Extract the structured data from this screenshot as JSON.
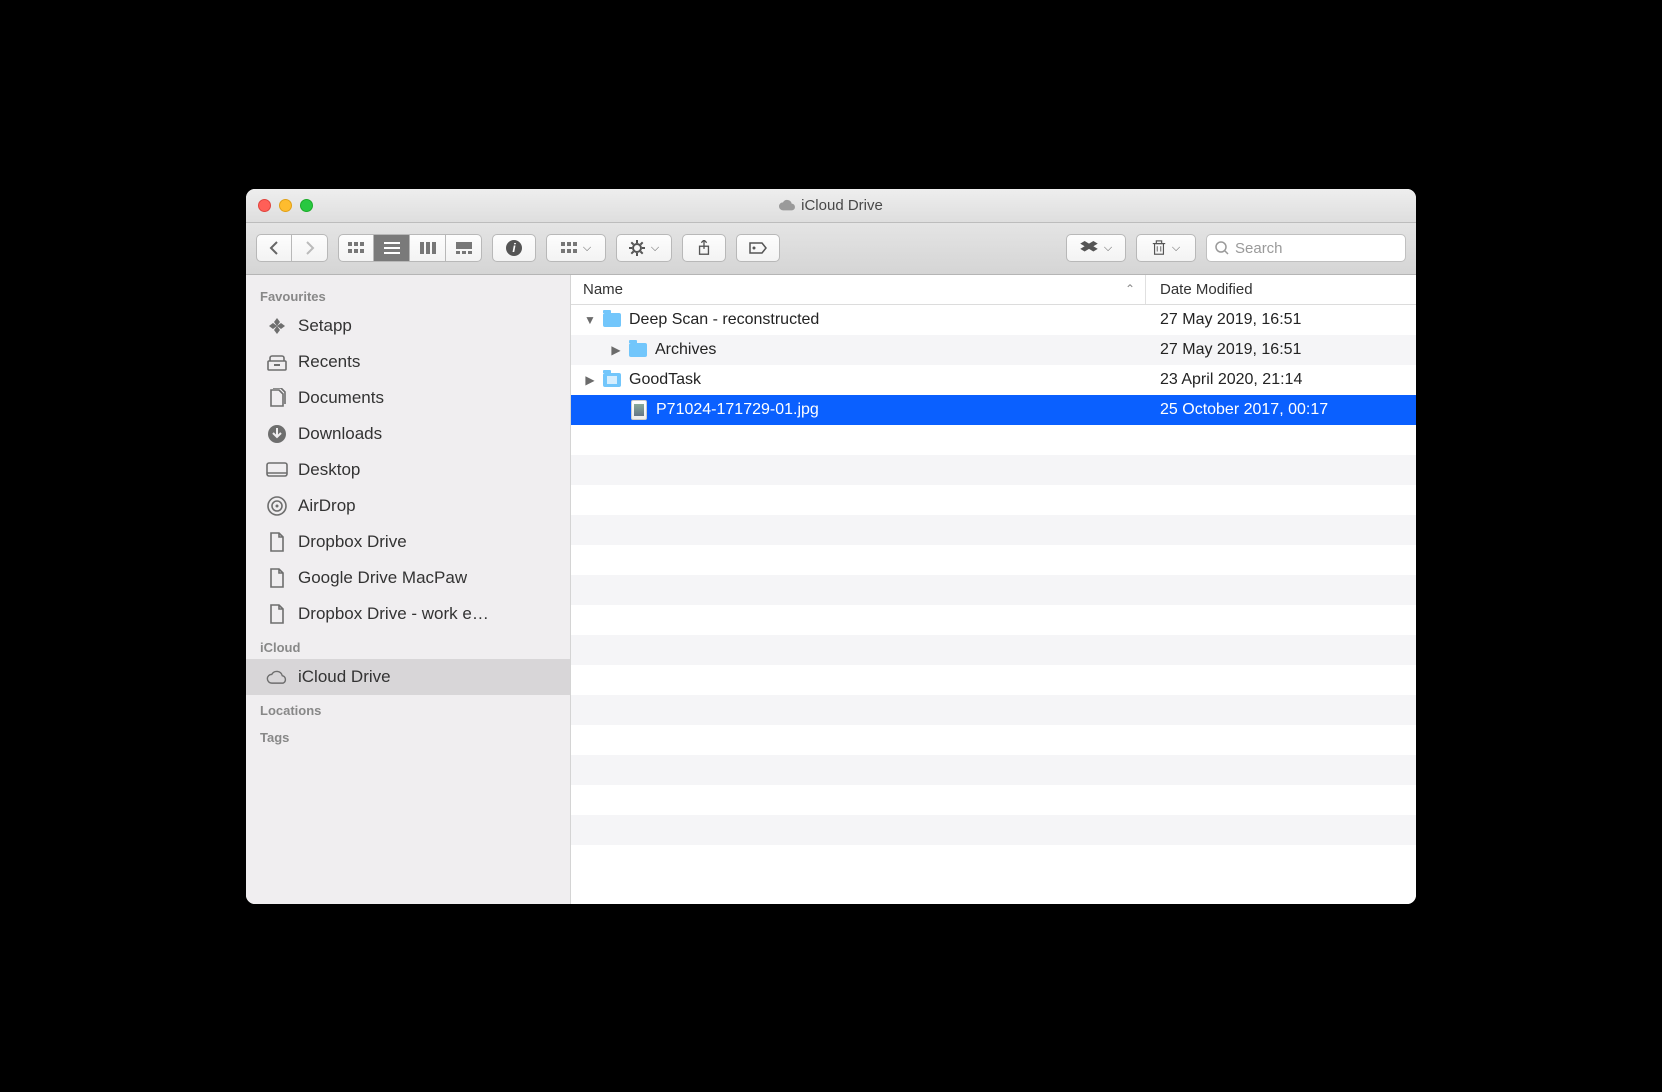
{
  "window": {
    "title": "iCloud Drive"
  },
  "search": {
    "placeholder": "Search"
  },
  "sidebar": {
    "sections": [
      {
        "title": "Favourites",
        "items": [
          {
            "label": "Setapp",
            "icon": "setapp"
          },
          {
            "label": "Recents",
            "icon": "recents"
          },
          {
            "label": "Documents",
            "icon": "documents"
          },
          {
            "label": "Downloads",
            "icon": "downloads"
          },
          {
            "label": "Desktop",
            "icon": "desktop"
          },
          {
            "label": "AirDrop",
            "icon": "airdrop"
          },
          {
            "label": "Dropbox Drive",
            "icon": "file"
          },
          {
            "label": "Google Drive MacPaw",
            "icon": "file"
          },
          {
            "label": "Dropbox Drive - work e…",
            "icon": "file"
          }
        ]
      },
      {
        "title": "iCloud",
        "items": [
          {
            "label": "iCloud Drive",
            "icon": "cloud",
            "selected": true
          }
        ]
      },
      {
        "title": "Locations",
        "items": []
      },
      {
        "title": "Tags",
        "items": []
      }
    ]
  },
  "columns": {
    "name": "Name",
    "date": "Date Modified",
    "sort_asc": true
  },
  "files": [
    {
      "name": "Deep Scan - reconstructed",
      "type": "folder",
      "date": "27 May 2019, 16:51",
      "expanded": true,
      "level": 0
    },
    {
      "name": "Archives",
      "type": "folder",
      "date": "27 May 2019, 16:51",
      "expanded": false,
      "collapsed_arrow": true,
      "level": 1
    },
    {
      "name": "GoodTask",
      "type": "appfolder",
      "date": "23 April 2020, 21:14",
      "expanded": false,
      "collapsed_arrow": true,
      "level": 0
    },
    {
      "name": "P71024-171729-01.jpg",
      "type": "image",
      "date": "25 October 2017, 00:17",
      "selected": true,
      "level": 0
    }
  ]
}
